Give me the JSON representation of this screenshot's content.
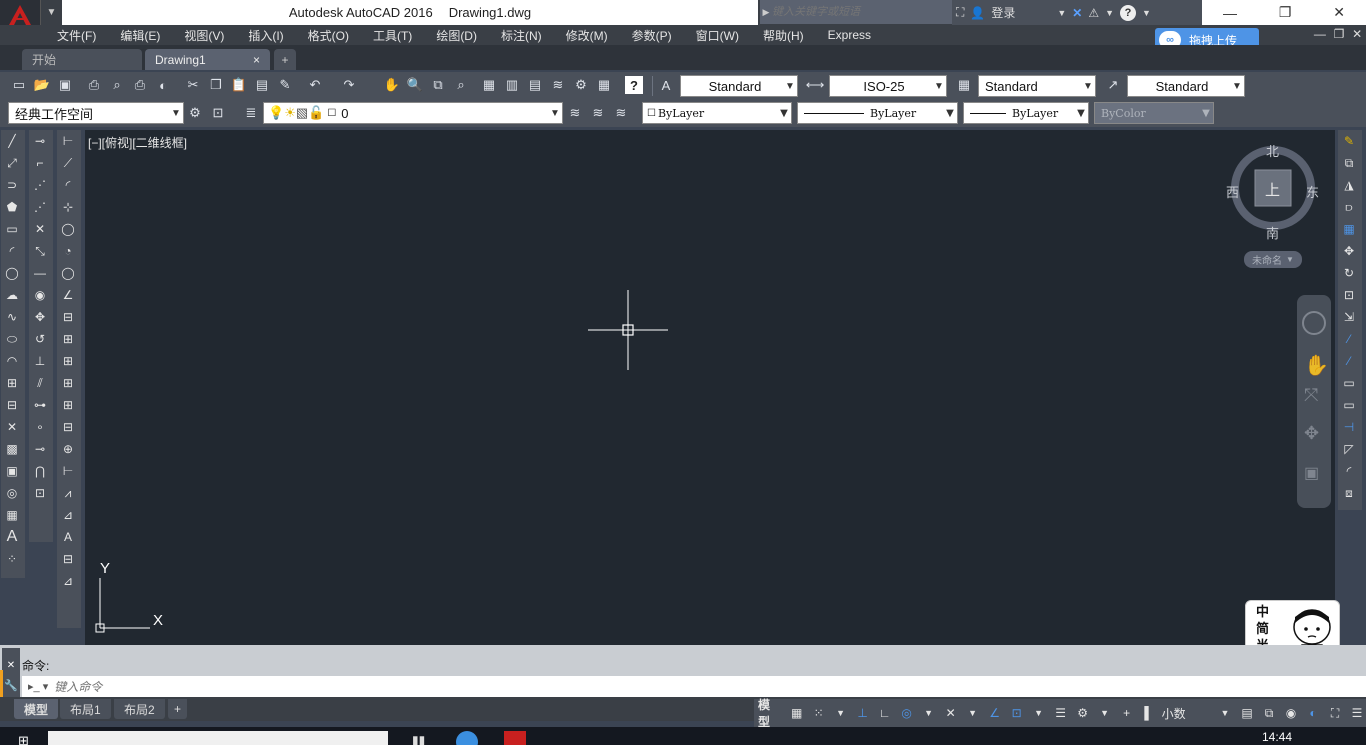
{
  "titlebar": {
    "app_name": "Autodesk AutoCAD 2016",
    "file_name": "Drawing1.dwg",
    "search_placeholder": "键入关键字或短语",
    "login_label": "登录",
    "help_icon": "?"
  },
  "menu": {
    "items": [
      "文件(F)",
      "编辑(E)",
      "视图(V)",
      "插入(I)",
      "格式(O)",
      "工具(T)",
      "绘图(D)",
      "标注(N)",
      "修改(M)",
      "参数(P)",
      "窗口(W)",
      "帮助(H)",
      "Express"
    ]
  },
  "upload_button": "拖拽上传",
  "tabs": {
    "start": "开始",
    "drawing": "Drawing1",
    "close": "×",
    "add": "+"
  },
  "toolbar1": {
    "text_style": "Standard",
    "dim_style": "ISO-25",
    "table_style": "Standard",
    "mleader_style": "Standard"
  },
  "toolbar2": {
    "workspace": "经典工作空间",
    "layer": "0",
    "color": "ByLayer",
    "linetype": "ByLayer",
    "lineweight": "ByLayer",
    "plotstyle": "ByColor"
  },
  "viewport": {
    "label": "[−][俯视][二维线框]",
    "axis_x": "X",
    "axis_y": "Y"
  },
  "viewcube": {
    "north": "北",
    "south": "南",
    "east": "东",
    "west": "西",
    "top": "上",
    "ucs_name": "未命名"
  },
  "command": {
    "history": "命令:",
    "placeholder": "键入命令"
  },
  "layout_tabs": [
    "模型",
    "布局1",
    "布局2",
    "+"
  ],
  "status": {
    "model": "模型",
    "units": "小数"
  },
  "ime_widget": {
    "chars": [
      "中",
      "简",
      "半"
    ]
  },
  "taskbar": {
    "time": "14:44"
  },
  "colors": {
    "canvas": "#212830",
    "chrome": "#4a505a",
    "accent": "#4e94e6",
    "logo_red": "#c8201f"
  }
}
